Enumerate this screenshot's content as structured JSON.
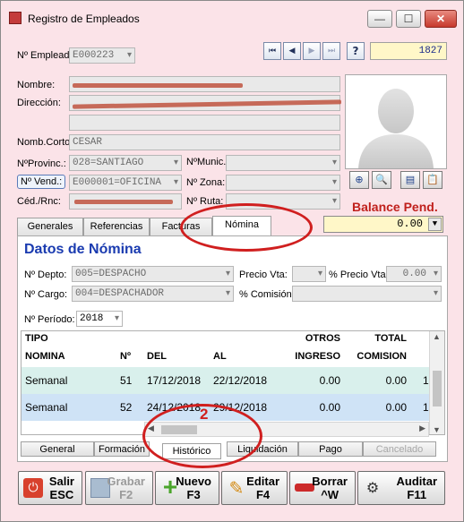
{
  "window": {
    "title": "Registro de Empleados",
    "controls": {
      "minimize": "—",
      "maximize": "☐",
      "close": "✕"
    }
  },
  "header": {
    "empleado_label": "Nº Empleado",
    "empleado_value": "E000223",
    "record_counter": "1827",
    "nav": [
      "first",
      "prev",
      "next",
      "last"
    ],
    "help_label": "?"
  },
  "form": {
    "nombre_label": "Nombre:",
    "direccion_label": "Dirección:",
    "nombre_corto_label": "Nomb.Corto",
    "nombre_corto_value": "CESAR",
    "provincia_label": "NºProvinc.:",
    "provincia_value": "028=SANTIAGO",
    "municipio_label": "NºMunic.",
    "vendedor_label": "Nº Vend.:",
    "vendedor_value": "E000001=OFICINA",
    "zona_label": "Nº Zona:",
    "cedula_label": "Céd./Rnc:",
    "ruta_label": "Nº Ruta:"
  },
  "balance": {
    "label": "Balance Pend.",
    "value": "0.00"
  },
  "tabs": [
    "Generales",
    "Referencias",
    "Facturas",
    "Nómina"
  ],
  "active_tab": "Nómina",
  "nomina": {
    "title": "Datos de Nómina",
    "depto_label": "Nº Depto:",
    "depto_value": "005=DESPACHO",
    "precio_vta_label": "Precio Vta:",
    "pct_precio_label": "% Precio Vta:",
    "pct_precio_value": "0.00",
    "cargo_label": "Nº Cargo:",
    "cargo_value": "004=DESPACHADOR",
    "comision_label": "% Comisión:",
    "periodo_label": "Nº Período:",
    "periodo_value": "2018"
  },
  "grid": {
    "headers": [
      {
        "top": "TIPO",
        "bottom": "NOMINA"
      },
      {
        "top": "",
        "bottom": "Nº"
      },
      {
        "top": "",
        "bottom": "DEL"
      },
      {
        "top": "",
        "bottom": "AL"
      },
      {
        "top": "OTROS",
        "bottom": "INGRESO"
      },
      {
        "top": "TOTAL",
        "bottom": "COMISION"
      }
    ],
    "rows": [
      [
        "Semanal",
        "51",
        "17/12/2018",
        "22/12/2018",
        "0.00",
        "0.00",
        "1"
      ],
      [
        "Semanal",
        "52",
        "24/12/2018",
        "29/12/2018",
        "0.00",
        "0.00",
        "1"
      ]
    ]
  },
  "subtabs": [
    "General",
    "Formación",
    "Histórico",
    "Liquidación",
    "Pago",
    "Cancelado"
  ],
  "active_subtab": "Histórico",
  "actions": [
    {
      "line1": "Salir",
      "line2": "ESC",
      "icon": "power-icon",
      "enabled": true
    },
    {
      "line1": "Grabar",
      "line2": "F2",
      "icon": "save-icon",
      "enabled": false
    },
    {
      "line1": "Nuevo",
      "line2": "F3",
      "icon": "plus-icon",
      "enabled": true
    },
    {
      "line1": "Editar",
      "line2": "F4",
      "icon": "pencil-icon",
      "enabled": true
    },
    {
      "line1": "Borrar",
      "line2": "^W",
      "icon": "minus-icon",
      "enabled": true
    },
    {
      "line1": "Auditar",
      "line2": "F11",
      "icon": "audit-icon",
      "enabled": true
    }
  ],
  "annotation": {
    "marker": "2",
    "color": "#d01f1f"
  }
}
